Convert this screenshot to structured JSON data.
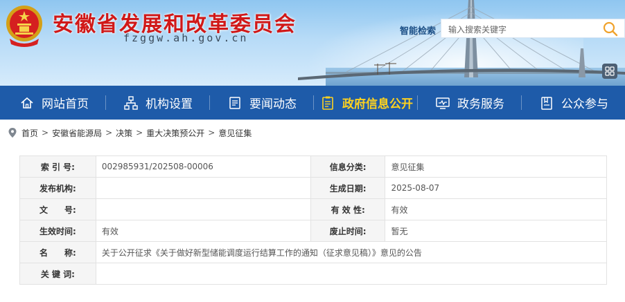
{
  "header": {
    "site_title": "安徽省发展和改革委员会",
    "site_domain": "fzggw.ah.gov.cn",
    "emblem_icon": "national-emblem-icon"
  },
  "search": {
    "label": "智能检索",
    "placeholder": "输入搜索关键字",
    "icon": "search-icon"
  },
  "nav": {
    "items": [
      {
        "label": "网站首页",
        "icon": "home-icon"
      },
      {
        "label": "机构设置",
        "icon": "org-chart-icon"
      },
      {
        "label": "要闻动态",
        "icon": "document-icon"
      },
      {
        "label": "政府信息公开",
        "icon": "info-doc-icon",
        "active": true
      },
      {
        "label": "政务服务",
        "icon": "monitor-icon"
      },
      {
        "label": "公众参与",
        "icon": "bookmark-icon"
      }
    ],
    "active_color": "#ffd21f",
    "bg_color": "#1e5ba9"
  },
  "breadcrumb": {
    "items": [
      "首页",
      "安徽省能源局",
      "决策",
      "重大决策预公开",
      "意见征集"
    ],
    "separator": ">"
  },
  "info_table": {
    "index_no_label": "索 引 号:",
    "index_no_value": "002985931/202508-00006",
    "category_label": "信息分类:",
    "category_value": "意见征集",
    "publisher_label": "发布机构:",
    "publisher_value": "",
    "created_label": "生成日期:",
    "created_value": "2025-08-07",
    "doc_no_label": "文　　号:",
    "doc_no_value": "",
    "validity_label": "有 效 性:",
    "validity_value": "有效",
    "effective_label": "生效时间:",
    "effective_value": "有效",
    "expire_label": "废止时间:",
    "expire_value": "暂无",
    "name_label": "名　　称:",
    "name_value": "关于公开征求《关于做好新型储能调度运行结算工作的通知（征求意见稿）》意见的公告",
    "keywords_label": "关 键 词:",
    "keywords_value": ""
  }
}
